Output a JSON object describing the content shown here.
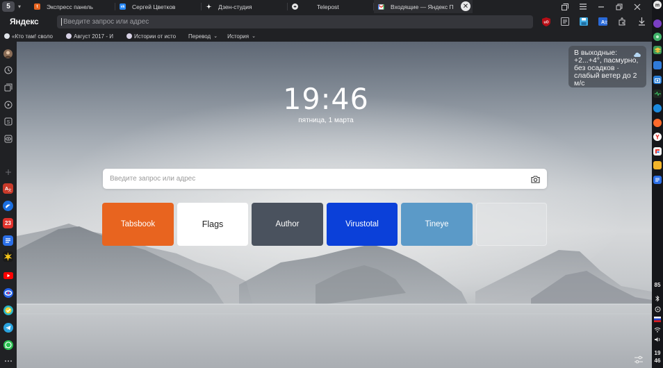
{
  "workspace": {
    "label": "5"
  },
  "tabs": [
    {
      "title": "Экспресс панель",
      "favicon": "tabsbook-icon",
      "color": "#e8641f",
      "active": false
    },
    {
      "title": "Сергей Цветков",
      "favicon": "vk-icon",
      "color": "#2787f5",
      "active": false
    },
    {
      "title": "Дзен-студия",
      "favicon": "dzen-icon",
      "color": "#000000",
      "active": false
    },
    {
      "title": "Telepost",
      "favicon": "telepost-icon",
      "color": "#2b2b2b",
      "active": false
    },
    {
      "title": "Входящие — Яндекс П",
      "favicon": "gmail-icon",
      "color": "#ea4335",
      "active": true
    }
  ],
  "browser": {
    "logo": "Яндекс",
    "omnibox_placeholder": "Введите запрос или адрес"
  },
  "bookmarks": [
    {
      "label": "«Кто там! своло",
      "type": "link"
    },
    {
      "label": "Август 2017 - И",
      "type": "link"
    },
    {
      "label": "Истории от исто",
      "type": "link"
    },
    {
      "label": "Перевод",
      "type": "folder"
    },
    {
      "label": "История",
      "type": "folder"
    }
  ],
  "newtab": {
    "time": "19:46",
    "date": "пятница, 1 марта",
    "weather": "В выходные: +2...+4°, пасмурно, без осадков · слабый ветер до 2 м/с",
    "search_placeholder": "Введите запрос или адрес",
    "tiles": [
      {
        "label": "Tabsbook",
        "color": "#e8641f"
      },
      {
        "label": "Flags",
        "color": "#ffffff"
      },
      {
        "label": "Author",
        "color": "#4a525e"
      },
      {
        "label": "Virustotal",
        "color": "#0b40d9"
      },
      {
        "label": "Tineye",
        "color": "#5b9ac8"
      },
      {
        "label": "",
        "color": "#e1e3e6"
      }
    ]
  },
  "sidebar": {
    "items": [
      "avatar",
      "history-icon",
      "collections-icon",
      "media-icon",
      "s-icon",
      "eye-icon",
      "add-icon",
      "translate-app",
      "app-blue",
      "calendar-app",
      "docs-app",
      "burst-app",
      "youtube-app",
      "mail-app",
      "check-app",
      "telegram-app",
      "whatsapp-app",
      "more-icon"
    ],
    "calendar_label": "23"
  },
  "taskbar": {
    "battery": "85",
    "clock_hour": "19",
    "clock_min": "46"
  }
}
